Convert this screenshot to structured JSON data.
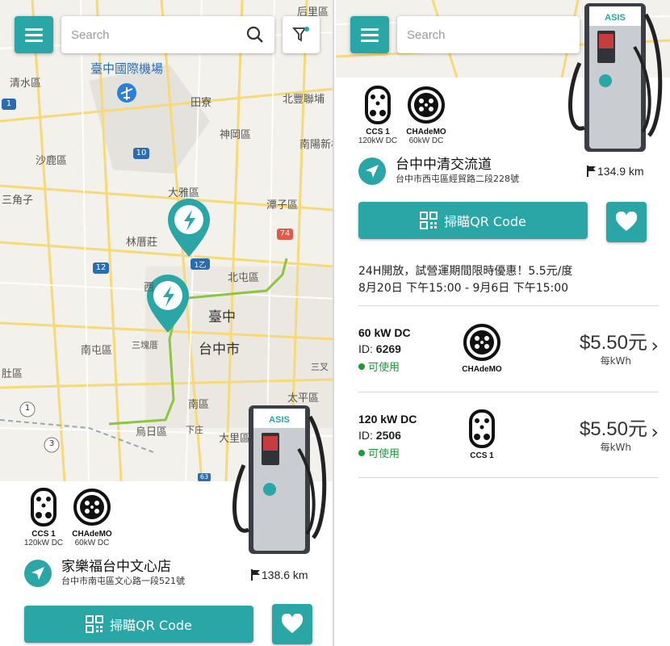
{
  "colors": {
    "accent": "#2aa6a6",
    "available": "#1e9a3a",
    "route": "#8cc63f"
  },
  "search": {
    "placeholder": "Search"
  },
  "map": {
    "labels": {
      "houlihan": "后里區",
      "airport": "臺中國際機場",
      "qingshui": "清水區",
      "tianliao": "田寮",
      "beifeng": "北豐聯埔",
      "shengang": "神岡區",
      "nanyang": "南陽新村",
      "shalu": "沙鹿區",
      "sanjiaozi": "三角子",
      "daya": "大雅區",
      "tanzi": "潭子區",
      "linlu": "林厝莊",
      "beitun": "北屯區",
      "xi": "西",
      "taizhong": "臺中",
      "taizhongshi": "台中市",
      "nantun": "南屯區",
      "sankuaicuo": "三塊厝",
      "sanyi": "三叉",
      "shanqu": "肚區",
      "nanqu": "南區",
      "taiping": "太平區",
      "wuri": "烏日區",
      "xiazhuang": "下庄",
      "dali": "大里區"
    },
    "shields": {
      "s1": "1",
      "s10": "10",
      "s12": "12",
      "s74": "74",
      "s1yi": "1乙",
      "s3": "3",
      "s1b": "1",
      "s63": "63"
    }
  },
  "connectors": [
    {
      "name": "CCS 1",
      "spec": "120kW DC"
    },
    {
      "name": "CHAdeMO",
      "spec": "60kW DC"
    }
  ],
  "left_station": {
    "name": "家樂福台中文心店",
    "address": "台中市南屯區文心路一段521號",
    "distance": "138.6 km"
  },
  "right_station": {
    "name": "台中中清交流道",
    "address": "台中市西屯區經貿路二段228號",
    "distance": "134.9 km"
  },
  "brand": "ASIS",
  "qr_label": "掃瞄QR Code",
  "info": {
    "line1": "24H開放，試營運期間限時優惠！5.5元/度",
    "line2": "8月20日 下午15:00 - 9月6日 下午15:00"
  },
  "plugs": [
    {
      "power": "60 kW DC",
      "id_prefix": "ID: ",
      "id": "6269",
      "status": "可使用",
      "type": "CHAdeMO",
      "price": "$5.50元",
      "unit": "每kWh"
    },
    {
      "power": "120 kW DC",
      "id_prefix": "ID: ",
      "id": "2506",
      "status": "可使用",
      "type": "CCS 1",
      "price": "$5.50元",
      "unit": "每kWh"
    }
  ]
}
